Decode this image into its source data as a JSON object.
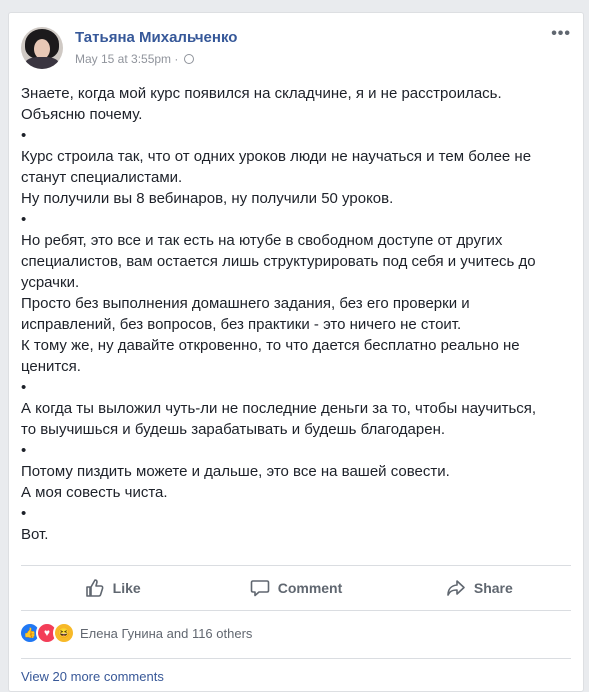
{
  "post": {
    "author": "Татьяна Михальченко",
    "timestamp": "May 15 at 3:55pm",
    "separator": "·",
    "privacy_icon": "globe-icon",
    "more_label": "•••",
    "paragraphs": [
      "Знаете, когда мой курс появился на складчине, я и не расстроилась.\nОбъясню почему.",
      "•",
      "Курс строила так, что от одних уроков люди не научаться и тем более не\nстанут специалистами.",
      "Ну получили вы 8 вебинаров, ну получили 50 уроков.",
      "•",
      "Но ребят, это все и так есть на ютубе в свободном доступе от других\nспециалистов, вам остается лишь структурировать под себя и учитесь до\nусрачки.",
      "Просто без выполнения домашнего задания, без его проверки и\nисправлений, без вопросов, без практики - это ничего не стоит.",
      "К тому же, ну давайте откровенно, то что дается бесплатно реально не\nценится.",
      "•",
      "А когда ты выложил чуть-ли не последние деньги за то, чтобы научиться,\nто выучишься и будешь зарабатывать и будешь благодарен.",
      "•",
      "Потому пиздить можете и дальше, это все на вашей совести.",
      "А моя совесть чиста.",
      "•",
      "Вот."
    ]
  },
  "actions": {
    "like": "Like",
    "comment": "Comment",
    "share": "Share"
  },
  "reactions": {
    "summary": "Елена Гунина and 116 others",
    "colors": {
      "like": "#2078f4",
      "love": "#f33e58",
      "haha": "#f7b928"
    }
  },
  "comments": {
    "view_more": "View 20 more comments"
  }
}
